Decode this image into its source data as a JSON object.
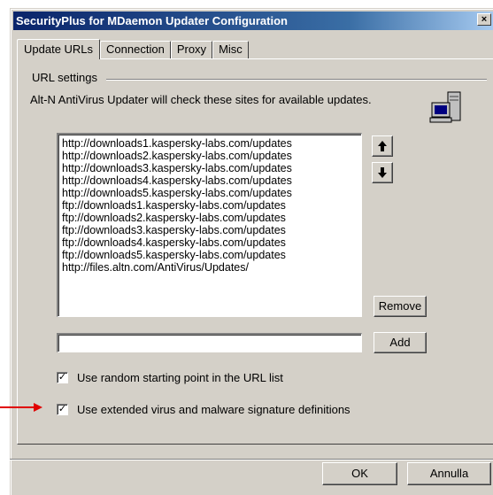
{
  "window": {
    "title": "SecurityPlus for MDaemon Updater Configuration",
    "close_label": "×"
  },
  "tabs": [
    {
      "label": "Update URLs",
      "active": true
    },
    {
      "label": "Connection",
      "active": false
    },
    {
      "label": "Proxy",
      "active": false
    },
    {
      "label": "Misc",
      "active": false
    }
  ],
  "url_settings": {
    "group_label": "URL settings",
    "description": "Alt-N AntiVirus Updater will check these sites for available updates.",
    "urls": [
      "http://downloads1.kaspersky-labs.com/updates",
      "http://downloads2.kaspersky-labs.com/updates",
      "http://downloads3.kaspersky-labs.com/updates",
      "http://downloads4.kaspersky-labs.com/updates",
      "http://downloads5.kaspersky-labs.com/updates",
      "ftp://downloads1.kaspersky-labs.com/updates",
      "ftp://downloads2.kaspersky-labs.com/updates",
      "ftp://downloads3.kaspersky-labs.com/updates",
      "ftp://downloads4.kaspersky-labs.com/updates",
      "ftp://downloads5.kaspersky-labs.com/updates",
      "http://files.altn.com/AntiVirus/Updates/"
    ],
    "move_up_icon": "arrow-up-icon",
    "move_down_icon": "arrow-down-icon",
    "remove_label": "Remove",
    "new_url_value": "",
    "add_label": "Add"
  },
  "options": {
    "random_start": {
      "label": "Use random starting point in the URL list",
      "checked": true
    },
    "extended_defs": {
      "label": "Use extended virus and malware signature definitions",
      "checked": true
    }
  },
  "footer": {
    "ok_label": "OK",
    "cancel_label": "Annulla"
  },
  "colors": {
    "dialog_bg": "#d4d0c8",
    "title_start": "#0a246a",
    "title_end": "#a6caf0",
    "annotation_arrow": "#e00000"
  }
}
